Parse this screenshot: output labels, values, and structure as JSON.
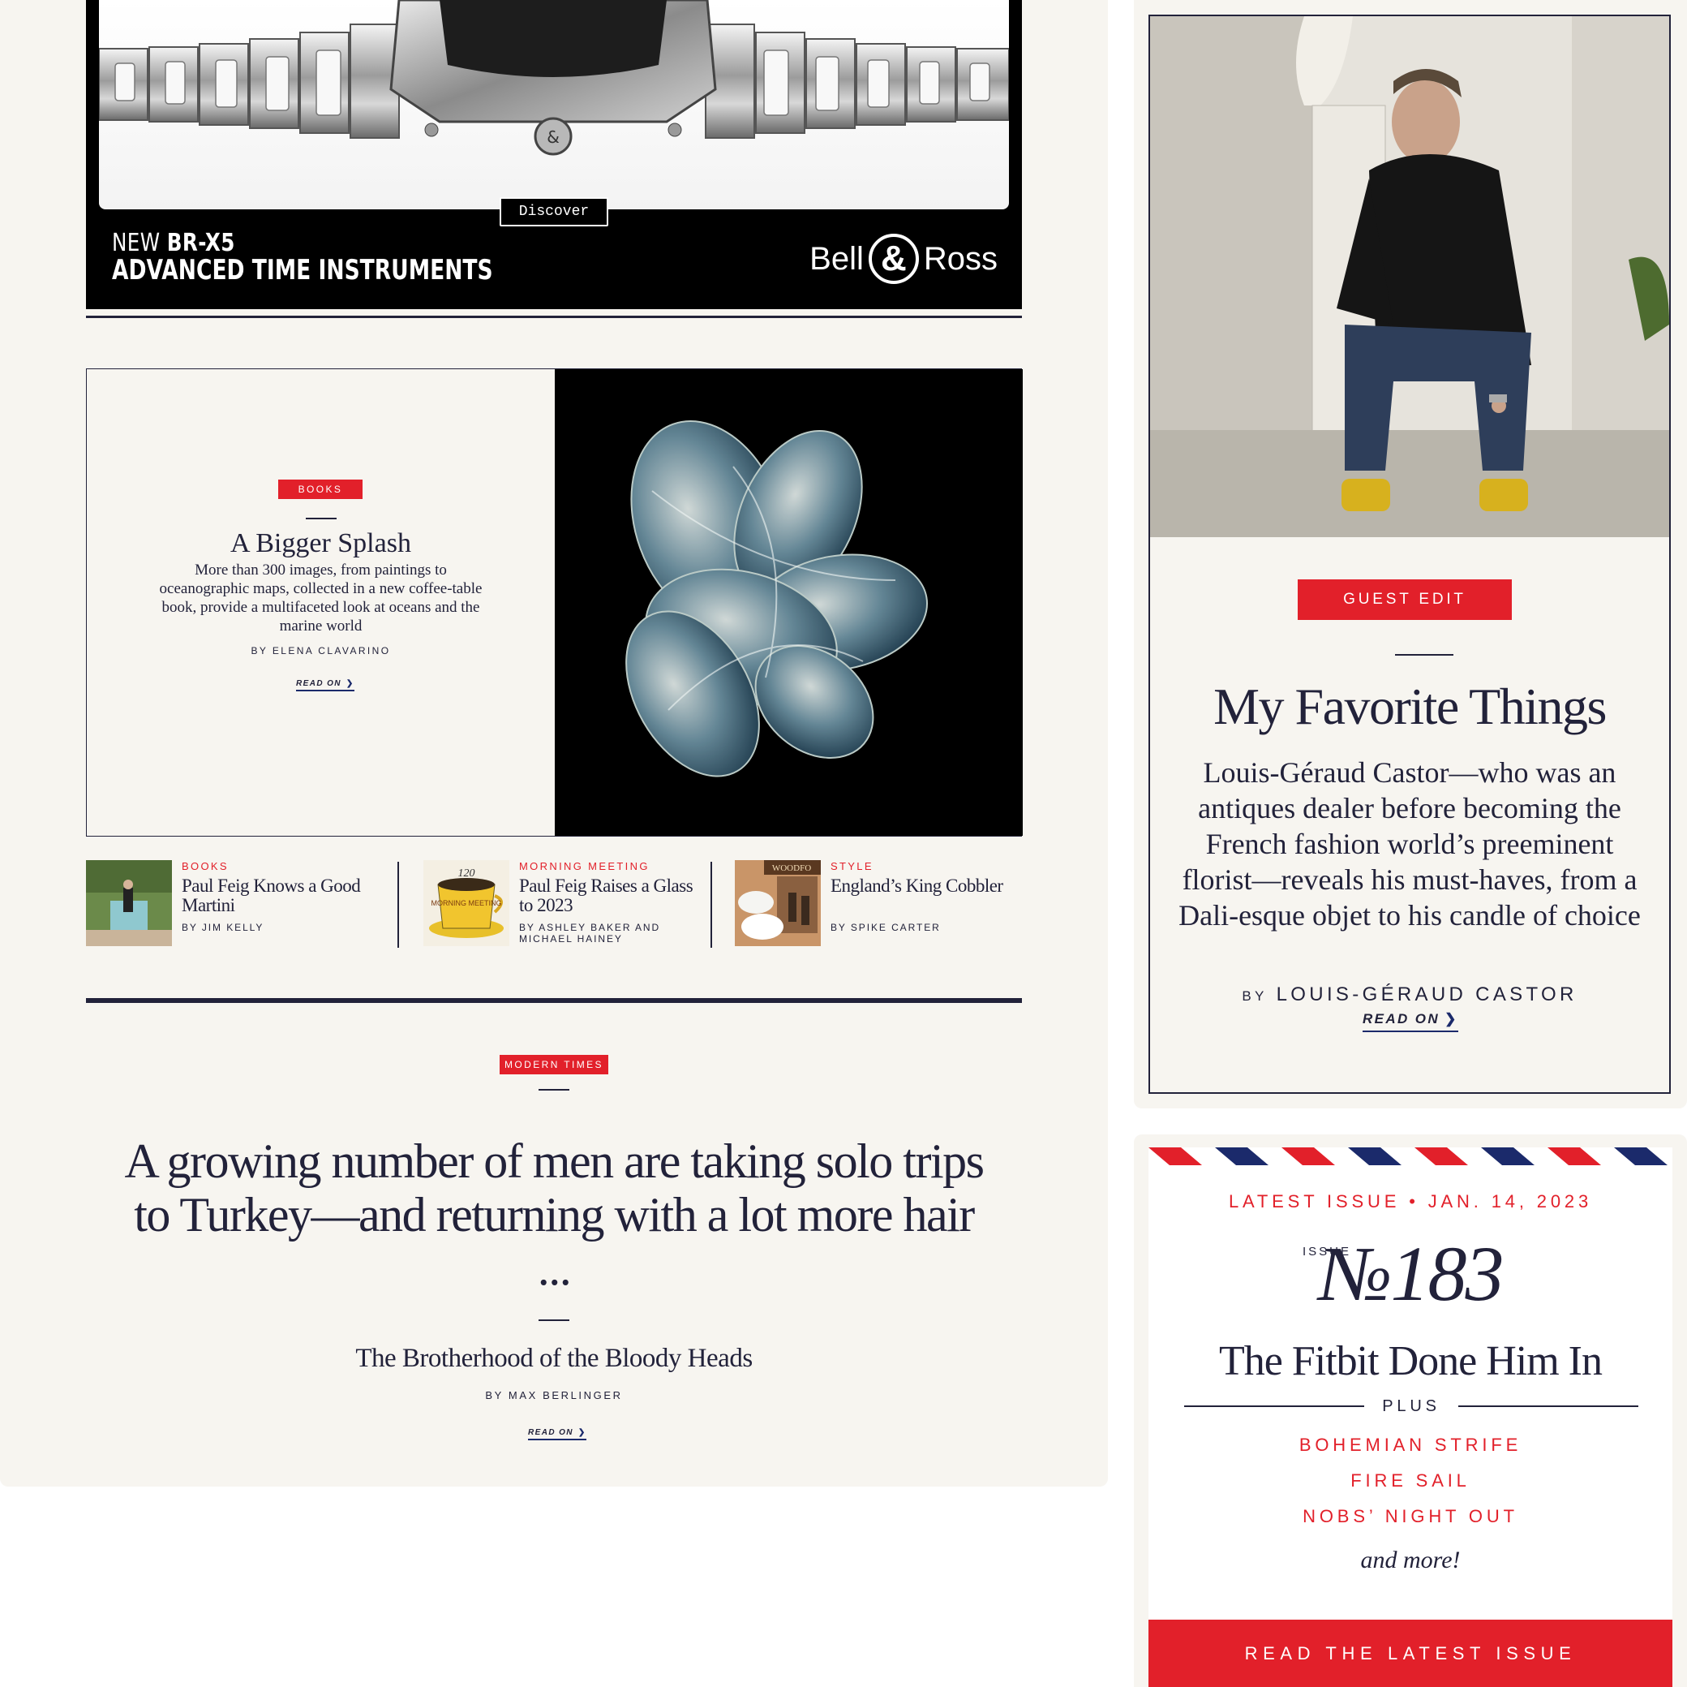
{
  "ad": {
    "discover_label": "Discover",
    "line1_prefix": "NEW ",
    "line1_model": "BR-X5",
    "line2": "ADVANCED TIME INSTRUMENTS",
    "brand_left": "Bell",
    "brand_amp": "&",
    "brand_right": "Ross"
  },
  "feature": {
    "kicker": "BOOKS",
    "title": "A Bigger Splash",
    "deck": "More than 300 images, from paintings to oceanographic maps, collected in a new coffee-table book, provide a multifaceted look at oceans and the marine world",
    "byline": "BY ELENA CLAVARINO",
    "read_on": "READ ON"
  },
  "minis": [
    {
      "kicker": "BOOKS",
      "headline": "Paul Feig Knows a Good Martini",
      "byline": "BY JIM KELLY",
      "thumb": "man-dancing-by-pool-photo"
    },
    {
      "kicker": "MORNING MEETING",
      "headline": "Paul Feig Raises a Glass to 2023",
      "byline": "BY ASHLEY BAKER AND MICHAEL HAINEY",
      "thumb": "morning-meeting-mug-illustration",
      "thumb_text": "MORNING MEETING",
      "thumb_num": "120"
    },
    {
      "kicker": "STYLE",
      "headline": "England’s King Cobbler",
      "byline": "BY SPIKE CARTER",
      "thumb": "shoes-storefront-photo",
      "thumb_sign": "WOODFO"
    }
  ],
  "modern": {
    "kicker": "MODERN TIMES",
    "headline": "A growing number of men are taking solo trips to Turkey—and returning with a lot more hair ...",
    "subhead": "The Brotherhood of the Bloody Heads",
    "byline": "BY MAX BERLINGER",
    "read_on": "READ ON"
  },
  "guest": {
    "kicker": "GUEST EDIT",
    "title": "My Favorite Things",
    "deck": "Louis-Géraud Castor—who was an antiques dealer before becoming the French fashion world’s preeminent florist—reveals his must-haves, from a Dali-esque objet to his candle of choice",
    "byline_by": "BY",
    "byline_name": "LOUIS-GÉRAUD CASTOR",
    "read_on": "READ ON"
  },
  "issue": {
    "date_line": "LATEST ISSUE • JAN. 14, 2023",
    "issue_label": "ISSUE",
    "issue_number": "№183",
    "title": "The Fitbit Done Him In",
    "plus": "PLUS",
    "items": [
      "BOHEMIAN STRIFE",
      "FIRE SAIL",
      "NOBS’ NIGHT OUT"
    ],
    "more": "and more!",
    "cta": "READ THE LATEST ISSUE"
  },
  "colors": {
    "accent_red": "#e2202a",
    "navy": "#1b2a6b",
    "ink": "#22223a",
    "paper": "#f7f5f0"
  }
}
